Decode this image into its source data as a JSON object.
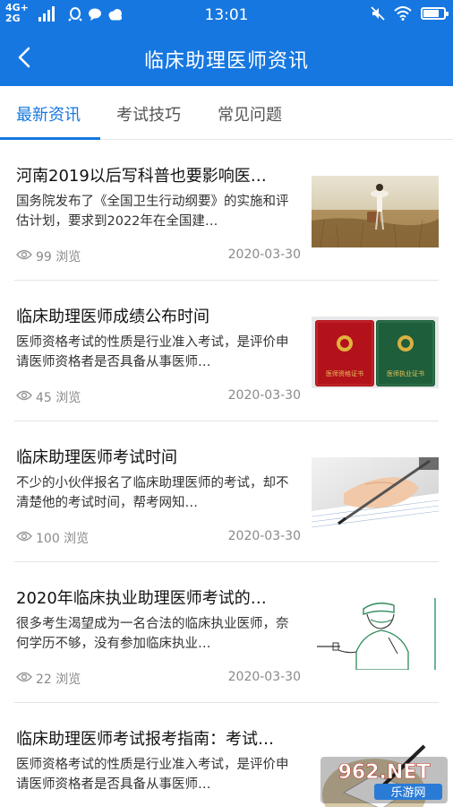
{
  "status_bar": {
    "network_top": "4G+",
    "network_bottom": "2G",
    "time": "13:01",
    "icons": [
      "qq-icon",
      "message-bubble-icon",
      "cloud-icon",
      "mute-icon",
      "wifi-icon",
      "battery-icon"
    ]
  },
  "header": {
    "title": "临床助理医师资讯",
    "back_icon": "chevron-left-icon"
  },
  "tabs": [
    {
      "label": "最新资讯",
      "active": true
    },
    {
      "label": "考试技巧",
      "active": false
    },
    {
      "label": "常见问题",
      "active": false
    }
  ],
  "articles": [
    {
      "title": "河南2019以后写科普也要影响医…",
      "summary": "国务院发布了《全国卫生行动纲要》的实施和评估计划，要求到2022年在全国建…",
      "views": "99 浏览",
      "date": "2020-03-30",
      "thumbnail": "girl-in-field-image"
    },
    {
      "title": "临床助理医师成绩公布时间",
      "summary": "医师资格考试的性质是行业准入考试，是评价申请医师资格者是否具备从事医师…",
      "views": "45 浏览",
      "date": "2020-03-30",
      "thumbnail": "certificates-image",
      "thumb_text": [
        "医师资格证书",
        "医师执业证书"
      ]
    },
    {
      "title": "临床助理医师考试时间",
      "summary": "不少的小伙伴报名了临床助理医师的考试，却不清楚他的考试时间，帮考网知…",
      "views": "100 浏览",
      "date": "2020-03-30",
      "thumbnail": "hand-writing-image"
    },
    {
      "title": "2020年临床执业助理医师考试的…",
      "summary": "很多考生渴望成为一名合法的临床执业医师，奈何学历不够，没有参加临床执业…",
      "views": "22 浏览",
      "date": "2020-03-30",
      "thumbnail": "doctor-sketch-image"
    },
    {
      "title": "临床助理医师考试报考指南：考试…",
      "summary": "医师资格考试的性质是行业准入考试，是评价申请医师资格者是否具备从事医师…",
      "views": "",
      "date": "",
      "thumbnail": "pen-book-image"
    }
  ],
  "watermark": {
    "brand": "962.NET",
    "subtitle": "乐游网"
  },
  "colors": {
    "primary": "#1677e0",
    "text": "#111111",
    "muted": "#8a8a8a",
    "divider": "#e4e4e4"
  }
}
